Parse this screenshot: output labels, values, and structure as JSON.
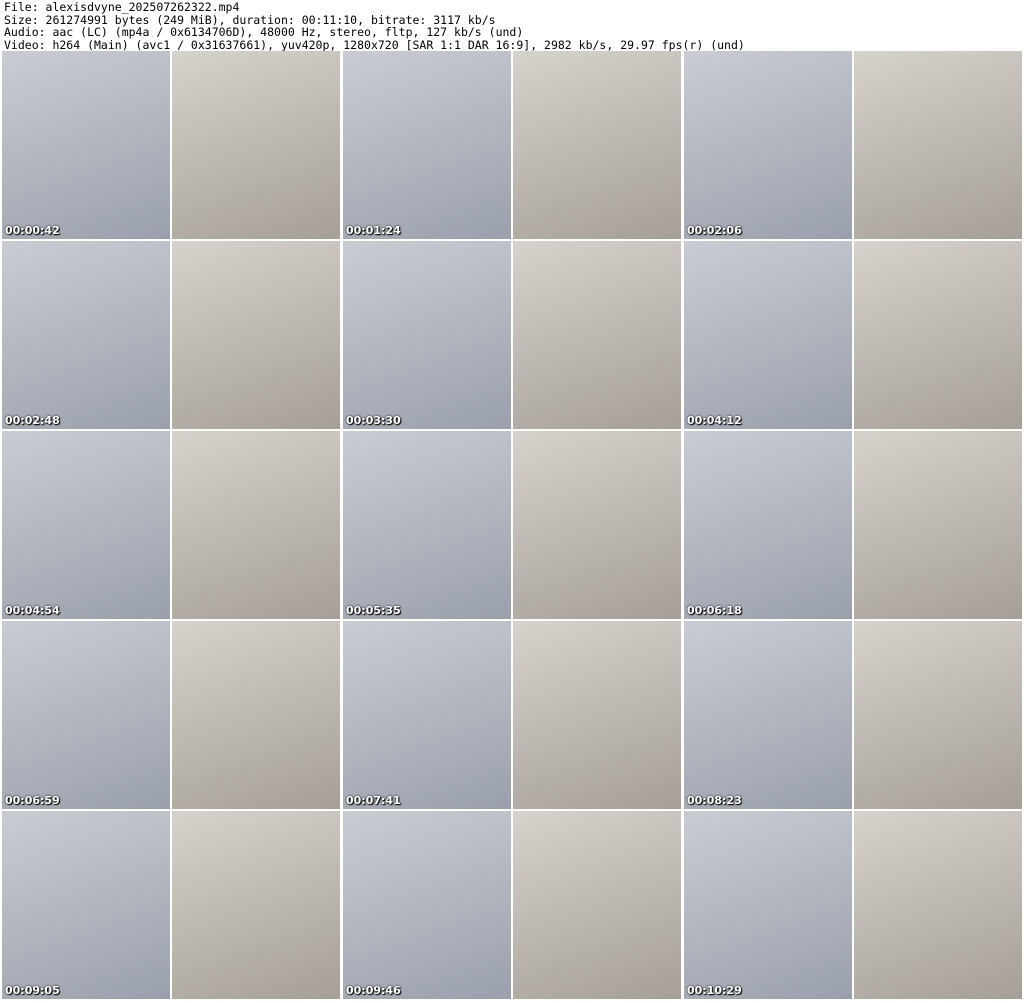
{
  "header": {
    "file": "File: alexisdvyne_202507262322.mp4",
    "size": "Size: 261274991 bytes (249 MiB), duration: 00:11:10, bitrate: 3117 kb/s",
    "audio": "Audio: aac (LC) (mp4a / 0x6134706D), 48000 Hz, stereo, fltp, 127 kb/s (und)",
    "video": "Video: h264 (Main) (avc1 / 0x31637661), yuv420p, 1280x720 [SAR 1:1 DAR 16:9], 2982 kb/s, 29.97 fps(r) (und)"
  },
  "thumbnails": [
    "00:00:42",
    "00:01:24",
    "00:02:06",
    "00:02:48",
    "00:03:30",
    "00:04:12",
    "00:04:54",
    "00:05:35",
    "00:06:18",
    "00:06:59",
    "00:07:41",
    "00:08:23",
    "00:09:05",
    "00:09:46",
    "00:10:29"
  ]
}
